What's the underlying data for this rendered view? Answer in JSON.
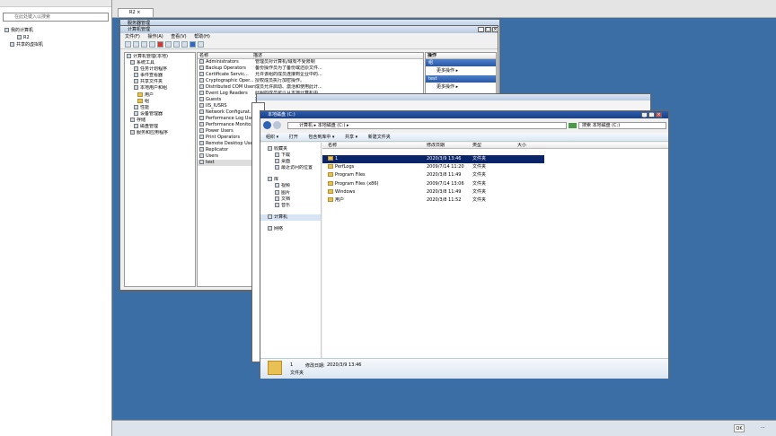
{
  "left_panel": {
    "search_placeholder": "在此处键入以搜索",
    "tree": [
      "我的计算机",
      "R2",
      "共享的虚拟机"
    ]
  },
  "host_tab": {
    "label": "R2"
  },
  "mmc": {
    "title_back": "服务器管理",
    "title": "计算机管理",
    "menu": [
      "文件(F)",
      "操作(A)",
      "查看(V)",
      "帮助(H)"
    ],
    "tree": [
      "计算机管理(本地)",
      "系统工具",
      "任务计划程序",
      "事件查看器",
      "共享文件夹",
      "本地用户和组",
      "用户",
      "组",
      "性能",
      "设备管理器",
      "存储",
      "磁盘管理",
      "服务和应用程序"
    ],
    "list_headers": [
      "名称",
      "描述"
    ],
    "rows": [
      [
        "Administrators",
        "管理员对计算机/域有不受限制"
      ],
      [
        "Backup Operators",
        "备份操作员为了备份或还原文件..."
      ],
      [
        "Certificate Servic...",
        "允许该组的成员连接到企业中的..."
      ],
      [
        "Cryptographic Oper...",
        "授权成员执行加密操作。"
      ],
      [
        "Distributed COM Users",
        "成员允许启动、激活和使用此计..."
      ],
      [
        "Event Log Readers",
        "此组的成员可以从本地计算机中..."
      ],
      [
        "Guests",
        "按默认值，来宾跟用户组的成员..."
      ],
      [
        "IIS_IUSRS",
        ""
      ],
      [
        "Network Configurat...",
        ""
      ],
      [
        "Performance Log Users",
        ""
      ],
      [
        "Performance Monito...",
        ""
      ],
      [
        "Power Users",
        ""
      ],
      [
        "Print Operators",
        ""
      ],
      [
        "Remote Desktop Users",
        ""
      ],
      [
        "Replicator",
        ""
      ],
      [
        "Users",
        ""
      ],
      [
        "test",
        ""
      ]
    ],
    "actions_header": "操作",
    "actions": [
      "组",
      "更多操作",
      "test",
      "更多操作"
    ]
  },
  "explorer": {
    "title": "本地磁盘 (C:)",
    "breadcrumb": "计算机 ▸ 本地磁盘 (C:) ▸",
    "search_placeholder": "搜索 本地磁盘 (C:)",
    "commands": [
      "组织 ▾",
      "打开",
      "包含到库中 ▾",
      "共享 ▾",
      "新建文件夹"
    ],
    "nav": [
      "收藏夹",
      "下载",
      "桌面",
      "最近访问的位置",
      "库",
      "视频",
      "图片",
      "文档",
      "音乐",
      "计算机",
      "网络"
    ],
    "columns": [
      "名称",
      "修改日期",
      "类型",
      "大小"
    ],
    "files": [
      {
        "name": "1",
        "date": "2020/3/9 13:46",
        "type": "文件夹"
      },
      {
        "name": "PerfLogs",
        "date": "2009/7/14 11:20",
        "type": "文件夹"
      },
      {
        "name": "Program Files",
        "date": "2020/3/8 11:49",
        "type": "文件夹"
      },
      {
        "name": "Program Files (x86)",
        "date": "2009/7/14 13:06",
        "type": "文件夹"
      },
      {
        "name": "Windows",
        "date": "2020/3/8 11:49",
        "type": "文件夹"
      },
      {
        "name": "用户",
        "date": "2020/3/8 11:52",
        "type": "文件夹"
      }
    ],
    "details": {
      "name": "1",
      "date_label": "修改日期:",
      "date": "2020/3/9 13:46",
      "type": "文件夹"
    }
  },
  "tray": {
    "ok": "OK",
    "clock": "..."
  }
}
